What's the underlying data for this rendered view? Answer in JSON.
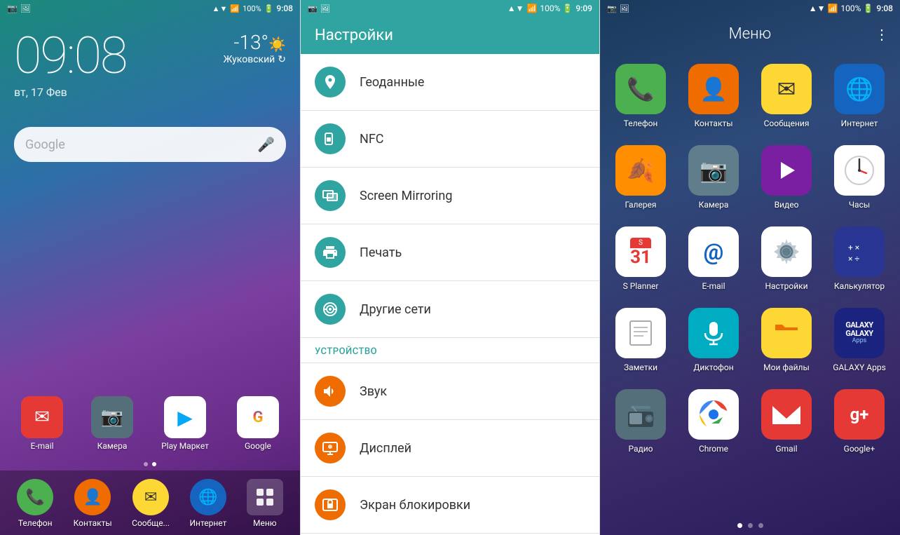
{
  "home": {
    "status_bar": {
      "time": "9:08",
      "battery": "100%",
      "signal": "▲▼",
      "icons_left": [
        "📷",
        "🖼️"
      ]
    },
    "time": "09:08",
    "date": "вт, 17 Фев",
    "weather": {
      "temp": "-13°",
      "city": "Жуковский"
    },
    "search_placeholder": "Google",
    "dock": [
      {
        "label": "E-mail",
        "icon": "✉",
        "bg": "#e53935"
      },
      {
        "label": "Камера",
        "icon": "📷",
        "bg": "#546e7a"
      },
      {
        "label": "Play\nМаркет",
        "icon": "▶",
        "bg": "white"
      },
      {
        "label": "Google",
        "icon": "G",
        "bg": "white"
      }
    ],
    "bottom_nav": [
      {
        "label": "Телефон",
        "icon": "📞",
        "bg": "#4caf50"
      },
      {
        "label": "Контакты",
        "icon": "👤",
        "bg": "#ef6c00"
      },
      {
        "label": "Сообще...",
        "icon": "✉",
        "bg": "#fdd835"
      },
      {
        "label": "Интернет",
        "icon": "🌐",
        "bg": "#1565c0"
      },
      {
        "label": "Меню",
        "icon": "⊞",
        "bg": "transparent"
      }
    ]
  },
  "settings": {
    "title": "Настройки",
    "time": "9:09",
    "items": [
      {
        "icon": "📍",
        "label": "Геоданные",
        "icon_bg": "#2fa4a0"
      },
      {
        "icon": "📳",
        "label": "NFC",
        "icon_bg": "#2fa4a0"
      },
      {
        "icon": "📺",
        "label": "Screen Mirroring",
        "icon_bg": "#2fa4a0"
      },
      {
        "icon": "🖨",
        "label": "Печать",
        "icon_bg": "#2fa4a0"
      },
      {
        "icon": "📡",
        "label": "Другие сети",
        "icon_bg": "#2fa4a0"
      }
    ],
    "section_device": "УСТРОЙСТВО",
    "device_items": [
      {
        "icon": "🔊",
        "label": "Звук",
        "icon_bg": "#ef6c00"
      },
      {
        "icon": "📱",
        "label": "Дисплей",
        "icon_bg": "#ef6c00"
      },
      {
        "icon": "🔒",
        "label": "Экран блокировки",
        "icon_bg": "#ef6c00"
      }
    ]
  },
  "menu": {
    "title": "Меню",
    "time": "9:08",
    "apps": [
      {
        "label": "Телефон",
        "icon": "📞",
        "bg": "#4caf50"
      },
      {
        "label": "Контакты",
        "icon": "👤",
        "bg": "#ef6c00"
      },
      {
        "label": "Сообщения",
        "icon": "✉",
        "bg": "#fdd835"
      },
      {
        "label": "Интернет",
        "icon": "🌐",
        "bg": "#1565c0"
      },
      {
        "label": "Галерея",
        "icon": "🌿",
        "bg": "#ff8f00"
      },
      {
        "label": "Камера",
        "icon": "📷",
        "bg": "#607d8b"
      },
      {
        "label": "Видео",
        "icon": "▶",
        "bg": "#7b1fa2"
      },
      {
        "label": "Часы",
        "icon": "🕐",
        "bg": "white"
      },
      {
        "label": "S Planner",
        "icon": "31",
        "bg": "white"
      },
      {
        "label": "E-mail",
        "icon": "@",
        "bg": "white"
      },
      {
        "label": "Настройки",
        "icon": "⚙",
        "bg": "white"
      },
      {
        "label": "Калькулятор",
        "icon": "🔢",
        "bg": "#283593"
      },
      {
        "label": "Заметки",
        "icon": "📝",
        "bg": "white"
      },
      {
        "label": "Диктофон",
        "icon": "🎙",
        "bg": "#00acc1"
      },
      {
        "label": "Мои файлы",
        "icon": "📁",
        "bg": "#fdd835"
      },
      {
        "label": "GALAXY\nApps",
        "icon": "G",
        "bg": "#1a237e"
      },
      {
        "label": "Радио",
        "icon": "📻",
        "bg": "#546e7a"
      },
      {
        "label": "Chrome",
        "icon": "◎",
        "bg": "white"
      },
      {
        "label": "Gmail",
        "icon": "M",
        "bg": "#e53935"
      },
      {
        "label": "Google+",
        "icon": "g+",
        "bg": "#e53935"
      }
    ],
    "dots": [
      0,
      1,
      2
    ],
    "active_dot": 0
  }
}
